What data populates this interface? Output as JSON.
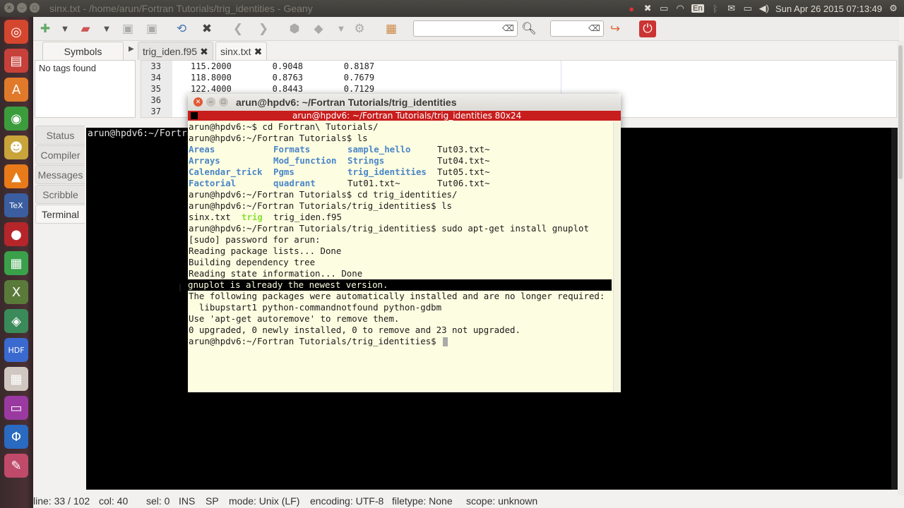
{
  "window_title": "sinx.txt - /home/arun/Fortran Tutorials/trig_identities - Geany",
  "topbar": {
    "lang": "En",
    "clock": "Sun Apr 26 2015 07:13:49"
  },
  "launcher": {
    "items": [
      {
        "name": "ubuntu-dash-icon",
        "glyph": "◎",
        "color": "#d5462e"
      },
      {
        "name": "files-icon",
        "glyph": "▤",
        "color": "#c7413a"
      },
      {
        "name": "software-center-icon",
        "glyph": "A",
        "color": "#e07a2a"
      },
      {
        "name": "chrome-icon",
        "glyph": "◉",
        "color": "#3c9c3c"
      },
      {
        "name": "gimp-icon",
        "glyph": "☻",
        "color": "#c8a43a"
      },
      {
        "name": "vlc-icon",
        "glyph": "▲",
        "color": "#e87a1a"
      },
      {
        "name": "tex-icon",
        "glyph": "TeX",
        "color": "#3a5ea0"
      },
      {
        "name": "app-red-icon",
        "glyph": "●",
        "color": "#b5262a"
      },
      {
        "name": "app-grid-icon",
        "glyph": "▦",
        "color": "#3aa04a"
      },
      {
        "name": "xfig-icon",
        "glyph": "X",
        "color": "#5a7a3a"
      },
      {
        "name": "cube-icon",
        "glyph": "◈",
        "color": "#3a8a5a"
      },
      {
        "name": "hdf-icon",
        "glyph": "HDF",
        "color": "#3a6ad0"
      },
      {
        "name": "calc-icon",
        "glyph": "▦",
        "color": "#d0c8c0"
      },
      {
        "name": "workspace-icon",
        "glyph": "▭",
        "color": "#9a3aa0"
      },
      {
        "name": "app-blue-icon",
        "glyph": "Φ",
        "color": "#2a6ac0"
      },
      {
        "name": "app-pencil-icon",
        "glyph": "✎",
        "color": "#c04a6a"
      }
    ]
  },
  "toolbar": {
    "search_placeholder": "",
    "goto_placeholder": ""
  },
  "sidebar": {
    "tab_label": "Symbols",
    "body_text": "No tags found"
  },
  "editor": {
    "tabs": [
      {
        "label": "trig_iden.f95",
        "close": "✖"
      },
      {
        "label": "sinx.txt",
        "close": "✖"
      }
    ],
    "lines": [
      {
        "num": "33",
        "text": "115.2000        0.9048        0.8187"
      },
      {
        "num": "34",
        "text": "118.8000        0.8763        0.7679"
      },
      {
        "num": "35",
        "text": "122.4000        0.8443        0.7129"
      },
      {
        "num": "36",
        "text": ""
      },
      {
        "num": "37",
        "text": ""
      }
    ]
  },
  "message_tabs": [
    "Status",
    "Compiler",
    "Messages",
    "Scribble",
    "Terminal"
  ],
  "vte_prompt": "arun@hpdv6:~/Fortran",
  "statusbar": {
    "line": "line: 33 / 102",
    "col": "col: 40",
    "sel": "sel: 0",
    "ins": "INS",
    "sp": "SP",
    "mode": "mode: Unix (LF)",
    "encoding": "encoding: UTF-8",
    "filetype": "filetype: None",
    "scope": "scope: unknown"
  },
  "terminal": {
    "title": "arun@hpdv6: ~/Fortran Tutorials/trig_identities",
    "bar_title": "arun@hpdv6: ~/Fortran Tutorials/trig_identities 80x24",
    "lines": [
      "arun@hpdv6:~$ cd Fortran\\ Tutorials/",
      "arun@hpdv6:~/Fortran Tutorials$ ls",
      "",
      "",
      "",
      "",
      "arun@hpdv6:~/Fortran Tutorials$ cd trig_identities/",
      "arun@hpdv6:~/Fortran Tutorials/trig_identities$ ls",
      "",
      "arun@hpdv6:~/Fortran Tutorials/trig_identities$ sudo apt-get install gnuplot",
      "[sudo] password for arun:",
      "Reading package lists... Done",
      "Building dependency tree",
      "Reading state information... Done",
      "gnuplot is already the newest version.",
      "The following packages were automatically installed and are no longer required:",
      "  libupstart1 python-commandnotfound python-gdbm",
      "Use 'apt-get autoremove' to remove them.",
      "0 upgraded, 0 newly installed, 0 to remove and 23 not upgraded.",
      "arun@hpdv6:~/Fortran Tutorials/trig_identities$ "
    ],
    "ls1": [
      [
        "Areas",
        "Formats",
        "sample_hello",
        "Tut03.txt~"
      ],
      [
        "Arrays",
        "Mod_function",
        "Strings",
        "Tut04.txt~"
      ],
      [
        "Calendar_trick",
        "Pgms",
        "trig_identities",
        "Tut05.txt~"
      ],
      [
        "Factorial",
        "quadrant",
        "Tut01.txt~",
        "Tut06.txt~"
      ]
    ],
    "ls2": [
      "sinx.txt",
      "trig",
      "trig_iden.f95"
    ]
  }
}
